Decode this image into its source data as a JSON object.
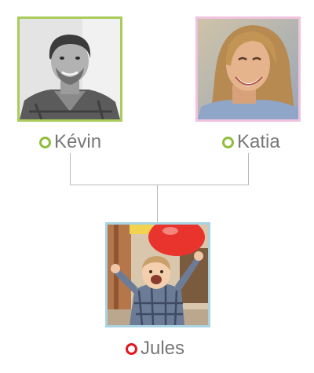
{
  "colors": {
    "father_frame": "#a9cc5a",
    "mother_frame": "#f0c2dd",
    "child_frame": "#a9d3e2",
    "connector": "#b9b9b9",
    "label_text": "#777777"
  },
  "parents": [
    {
      "name": "Kévin",
      "role": "father",
      "status_color": "#8fbd3c",
      "photo": "man-portrait-photo-bw"
    },
    {
      "name": "Katia",
      "role": "mother",
      "status_color": "#8fbd3c",
      "photo": "woman-portrait-photo"
    }
  ],
  "child": {
    "name": "Jules",
    "status_color": "#e2161d",
    "photo": "toddler-with-balloon-photo"
  }
}
